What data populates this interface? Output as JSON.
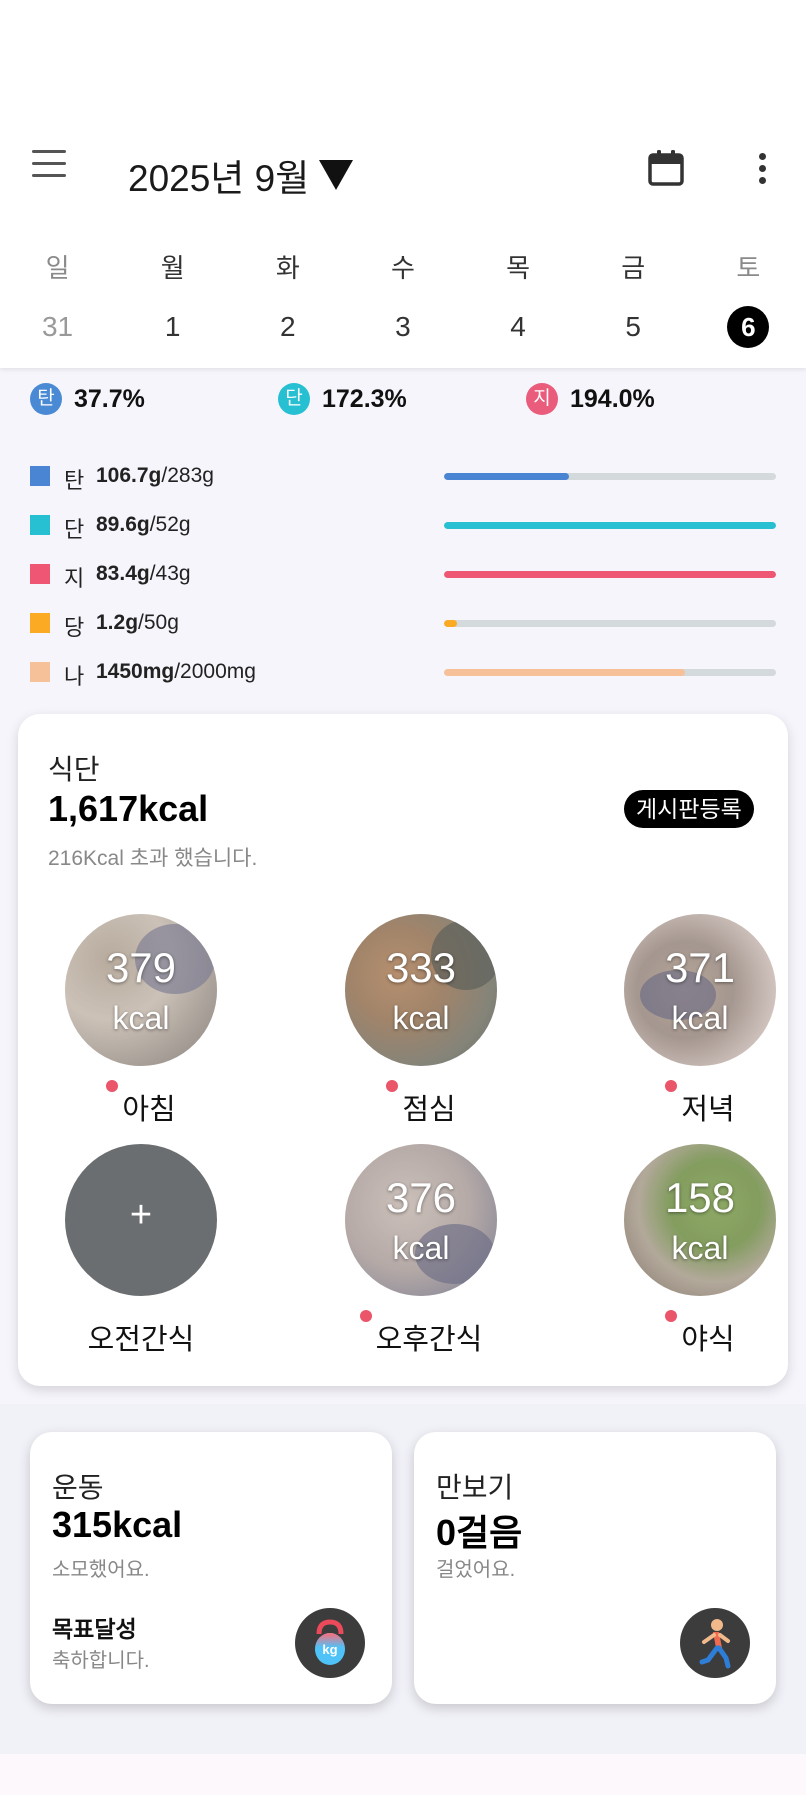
{
  "header": {
    "month_title": "2025년 9월",
    "weekdays": [
      "일",
      "월",
      "화",
      "수",
      "목",
      "금",
      "토"
    ],
    "dates": [
      "31",
      "1",
      "2",
      "3",
      "4",
      "5",
      "6"
    ],
    "selected_date": "6"
  },
  "macro_percent": [
    {
      "badge": "탄",
      "value": "37.7%",
      "color": "#4a8ad4"
    },
    {
      "badge": "단",
      "value": "172.3%",
      "color": "#27c0d2"
    },
    {
      "badge": "지",
      "value": "194.0%",
      "color": "#ea5c7c"
    }
  ],
  "nutrients": [
    {
      "name": "탄",
      "amount": "106.7g",
      "goal": "/283g",
      "color": "#4a85d3",
      "progress": 0.377
    },
    {
      "name": "단",
      "amount": "89.6g",
      "goal": "/52g",
      "color": "#27c0d2",
      "progress": 1.0
    },
    {
      "name": "지",
      "amount": "83.4g",
      "goal": "/43g",
      "color": "#ee5673",
      "progress": 1.0
    },
    {
      "name": "당",
      "amount": "1.2g",
      "goal": "/50g",
      "color": "#fbab23",
      "progress": 0.04
    },
    {
      "name": "나",
      "amount": "1450mg",
      "goal": "/2000mg",
      "color": "#f6c199",
      "progress": 0.725
    }
  ],
  "diet": {
    "title": "식단",
    "kcal": "1,617kcal",
    "sub": "216Kcal 초과 했습니다.",
    "board_button": "게시판등록",
    "meals": [
      {
        "label": "아침",
        "kcal": "379",
        "unit": "kcal"
      },
      {
        "label": "점심",
        "kcal": "333",
        "unit": "kcal"
      },
      {
        "label": "저녁",
        "kcal": "371",
        "unit": "kcal"
      },
      {
        "label": "오전간식",
        "plus": "+"
      },
      {
        "label": "오후간식",
        "kcal": "376",
        "unit": "kcal"
      },
      {
        "label": "야식",
        "kcal": "158",
        "unit": "kcal"
      }
    ]
  },
  "exercise": {
    "title": "운동",
    "kcal": "315kcal",
    "sub": "소모했어요.",
    "goal_title": "목표달성",
    "goal_sub": "축하합니다.",
    "icon": "kettlebell-icon",
    "icon_text": "kg"
  },
  "pedometer": {
    "title": "만보기",
    "steps": "0걸음",
    "sub": "걸었어요.",
    "icon": "runner-icon"
  }
}
